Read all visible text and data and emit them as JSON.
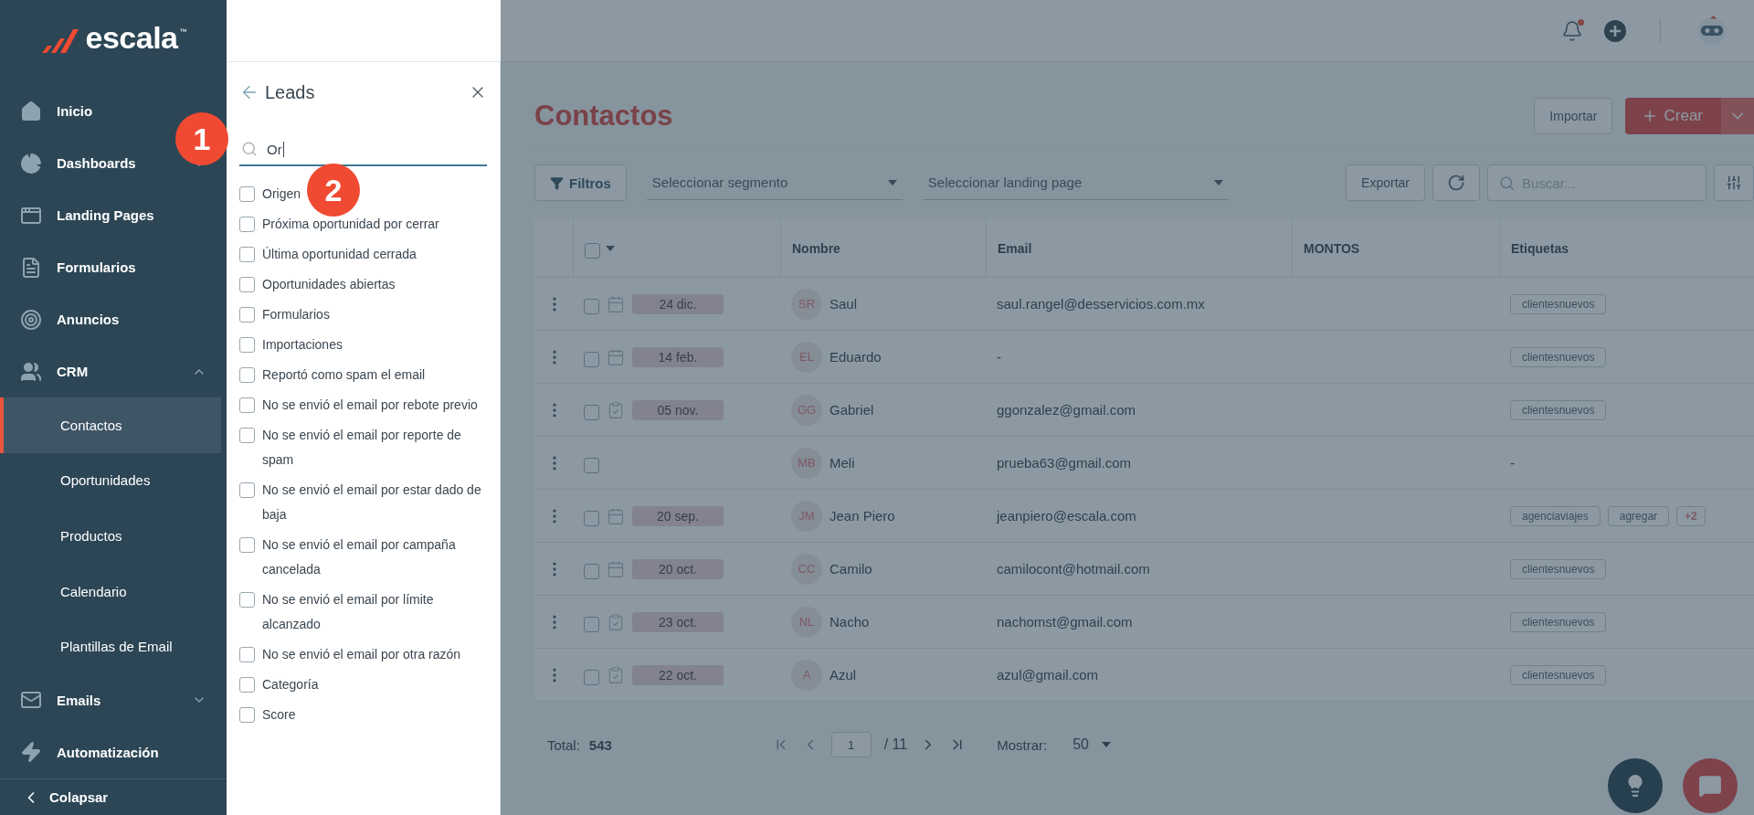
{
  "sidebar": {
    "logo": "escala",
    "trademark": "™",
    "items": [
      {
        "label": "Inicio",
        "selected": false
      },
      {
        "label": "Dashboards",
        "selected": false,
        "expanded": false
      },
      {
        "label": "Landing Pages",
        "selected": false
      },
      {
        "label": "Formularios",
        "selected": false
      },
      {
        "label": "Anuncios",
        "selected": false
      },
      {
        "label": "CRM",
        "selected": false,
        "expanded": true,
        "children": [
          {
            "label": "Contactos",
            "selected": true
          },
          {
            "label": "Oportunidades",
            "selected": false
          },
          {
            "label": "Productos",
            "selected": false
          },
          {
            "label": "Calendario",
            "selected": false
          },
          {
            "label": "Plantillas de Email",
            "selected": false
          }
        ]
      },
      {
        "label": "Emails",
        "selected": false,
        "expanded": false
      },
      {
        "label": "Automatización",
        "selected": false
      }
    ],
    "collapse": "Colapsar"
  },
  "drawer": {
    "title": "Leads",
    "search": {
      "value": "Or"
    },
    "options": [
      {
        "label": "Origen",
        "checked": false
      },
      {
        "label": "Próxima oportunidad por cerrar",
        "checked": false
      },
      {
        "label": "Última oportunidad cerrada",
        "checked": false
      },
      {
        "label": "Oportunidades abiertas",
        "checked": false
      },
      {
        "label": "Formularios",
        "checked": false
      },
      {
        "label": "Importaciones",
        "checked": false
      },
      {
        "label": "Reportó como spam el email",
        "checked": false
      },
      {
        "label": "No se envió el email por rebote previo",
        "checked": false
      },
      {
        "label": "No se envió el email por reporte de spam",
        "checked": false
      },
      {
        "label": "No se envió el email por estar dado de baja",
        "checked": false
      },
      {
        "label": "No se envió el email por campaña cancelada",
        "checked": false
      },
      {
        "label": "No se envió el email por límite alcanzado",
        "checked": false
      },
      {
        "label": "No se envió el email por otra razón",
        "checked": false
      },
      {
        "label": "Categoría",
        "checked": false
      },
      {
        "label": "Score",
        "checked": false
      }
    ]
  },
  "annotations": [
    {
      "label": "1"
    },
    {
      "label": "2"
    }
  ],
  "main": {
    "title": "Contactos",
    "import_button": "Importar",
    "create_button": "Crear",
    "toolbar": {
      "filters": "Filtros",
      "segment_select": {
        "placeholder": "Seleccionar segmento"
      },
      "landing_select": {
        "placeholder": "Seleccionar landing page"
      },
      "export": "Exportar",
      "search": {
        "placeholder": "Buscar..."
      }
    },
    "table": {
      "select_all": {
        "checked": false
      },
      "columns": [
        "Nombre",
        "Email",
        "MONTOS",
        "Etiquetas"
      ],
      "rows": [
        {
          "checked": false,
          "kind": "calendar",
          "date": "24 dic.",
          "initials": "SR",
          "name": "Saul",
          "email": "saul.rangel@desservicios.com.mx",
          "tags": [
            "clientesnuevos"
          ]
        },
        {
          "checked": false,
          "kind": "calendar",
          "date": "14 feb.",
          "initials": "EL",
          "name": "Eduardo",
          "email": "-",
          "tags": [
            "clientesnuevos"
          ]
        },
        {
          "checked": false,
          "kind": "clipboard",
          "date": "05 nov.",
          "initials": "GG",
          "name": "Gabriel",
          "email": "ggonzalez@gmail.com",
          "tags": [
            "clientesnuevos"
          ]
        },
        {
          "checked": false,
          "initials": "MB",
          "name": "Meli",
          "email": "prueba63@gmail.com",
          "tags_note": "-"
        },
        {
          "checked": false,
          "kind": "calendar",
          "date": "20 sep.",
          "initials": "JM",
          "name": "Jean Piero",
          "email": "jeanpiero@escala.com",
          "tags": [
            "agenciaviajes",
            "agregar"
          ],
          "more_tags": "+2"
        },
        {
          "checked": false,
          "kind": "calendar",
          "date": "20 oct.",
          "initials": "CC",
          "name": "Camilo",
          "email": "camilocont@hotmail.com",
          "tags": [
            "clientesnuevos"
          ]
        },
        {
          "checked": false,
          "kind": "clipboard",
          "date": "23 oct.",
          "initials": "NL",
          "name": "Nacho",
          "email": "nachomst@gmail.com",
          "tags": [
            "clientesnuevos"
          ]
        },
        {
          "checked": false,
          "kind": "clipboard",
          "date": "22 oct.",
          "initials": "A",
          "name": "Azul",
          "email": "azul@gmail.com",
          "tags": [
            "clientesnuevos"
          ]
        }
      ]
    },
    "footer": {
      "total_label": "Total:",
      "total": "543",
      "page": "1",
      "pages": "/ 11",
      "show_label": "Mostrar:",
      "show_value": "50"
    }
  }
}
